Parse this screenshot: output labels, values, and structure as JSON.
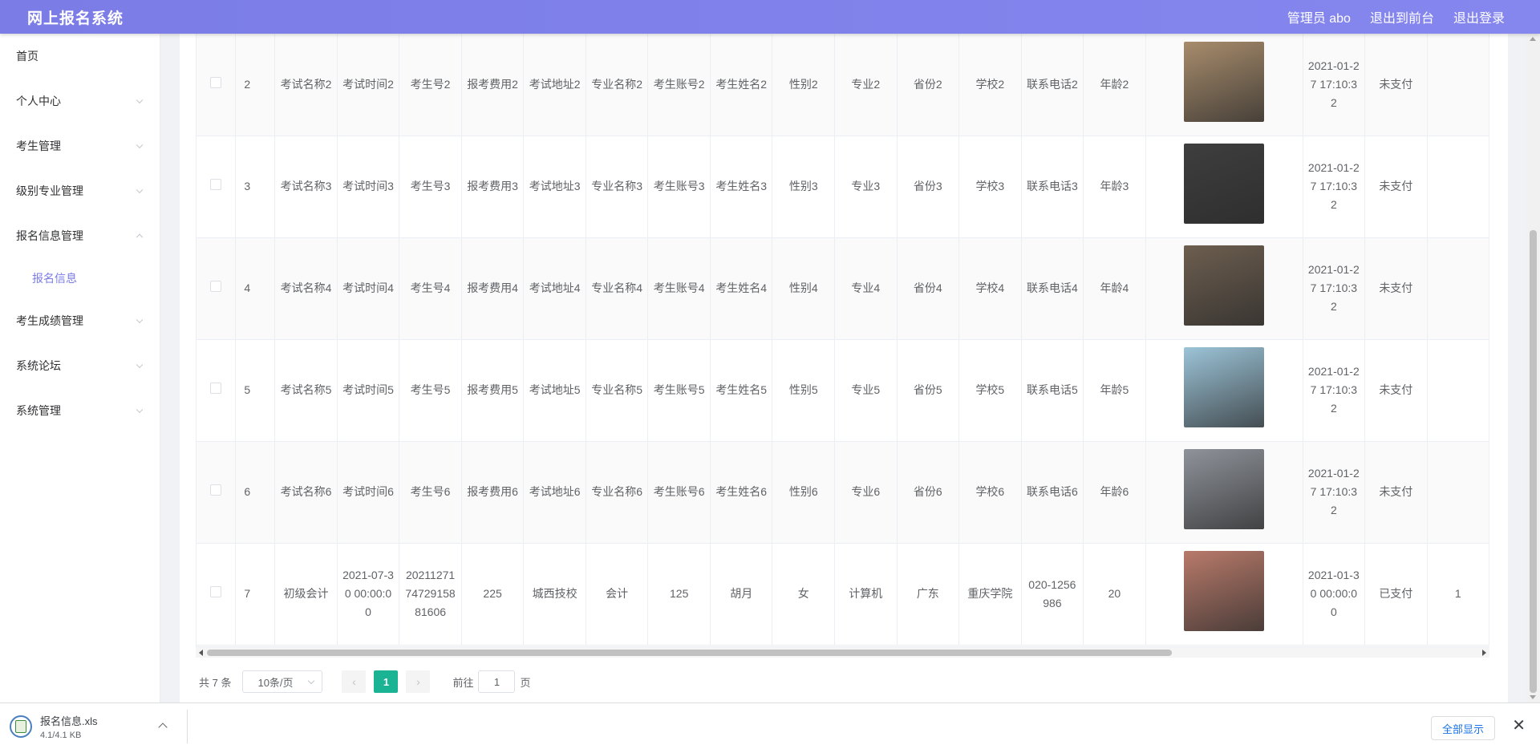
{
  "header": {
    "title": "网上报名系统",
    "admin": "管理员 abo",
    "to_front": "退出到前台",
    "logout": "退出登录"
  },
  "sidebar": {
    "items": [
      {
        "label": "首页"
      },
      {
        "label": "个人中心"
      },
      {
        "label": "考生管理"
      },
      {
        "label": "级别专业管理"
      },
      {
        "label": "报名信息管理"
      },
      {
        "label": "报名信息"
      },
      {
        "label": "考生成绩管理"
      },
      {
        "label": "系统论坛"
      },
      {
        "label": "系统管理"
      }
    ]
  },
  "table": {
    "rows": [
      {
        "idx": "2",
        "exam": "考试名称2",
        "time": "考试时间2",
        "no": "考生号2",
        "fee": "报考费用2",
        "addr": "考试地址2",
        "major": "专业名称2",
        "acct": "考生账号2",
        "name": "考生姓名2",
        "sex": "性别2",
        "prof": "专业2",
        "prov": "省份2",
        "school": "学校2",
        "phone": "联系电话2",
        "age": "年龄2",
        "photo_color": "#a88c6c",
        "created": "2021-01-27 17:10:32",
        "pay": "未支付"
      },
      {
        "idx": "3",
        "exam": "考试名称3",
        "time": "考试时间3",
        "no": "考生号3",
        "fee": "报考费用3",
        "addr": "考试地址3",
        "major": "专业名称3",
        "acct": "考生账号3",
        "name": "考生姓名3",
        "sex": "性别3",
        "prof": "专业3",
        "prov": "省份3",
        "school": "学校3",
        "phone": "联系电话3",
        "age": "年龄3",
        "photo_color": "#3e3e3e",
        "created": "2021-01-27 17:10:32",
        "pay": "未支付"
      },
      {
        "idx": "4",
        "exam": "考试名称4",
        "time": "考试时间4",
        "no": "考生号4",
        "fee": "报考费用4",
        "addr": "考试地址4",
        "major": "专业名称4",
        "acct": "考生账号4",
        "name": "考生姓名4",
        "sex": "性别4",
        "prof": "专业4",
        "prov": "省份4",
        "school": "学校4",
        "phone": "联系电话4",
        "age": "年龄4",
        "photo_color": "#6d5e4f",
        "created": "2021-01-27 17:10:32",
        "pay": "未支付"
      },
      {
        "idx": "5",
        "exam": "考试名称5",
        "time": "考试时间5",
        "no": "考生号5",
        "fee": "报考费用5",
        "addr": "考试地址5",
        "major": "专业名称5",
        "acct": "考生账号5",
        "name": "考生姓名5",
        "sex": "性别5",
        "prof": "专业5",
        "prov": "省份5",
        "school": "学校5",
        "phone": "联系电话5",
        "age": "年龄5",
        "photo_color": "#9cc4d8",
        "created": "2021-01-27 17:10:32",
        "pay": "未支付"
      },
      {
        "idx": "6",
        "exam": "考试名称6",
        "time": "考试时间6",
        "no": "考生号6",
        "fee": "报考费用6",
        "addr": "考试地址6",
        "major": "专业名称6",
        "acct": "考生账号6",
        "name": "考生姓名6",
        "sex": "性别6",
        "prof": "专业6",
        "prov": "省份6",
        "school": "学校6",
        "phone": "联系电话6",
        "age": "年龄6",
        "photo_color": "#8f939a",
        "created": "2021-01-27 17:10:32",
        "pay": "未支付"
      },
      {
        "idx": "7",
        "exam": "初级会计",
        "time": "2021-07-30 00:00:00",
        "no": "202112717472915881606",
        "fee": "225",
        "addr": "城西技校",
        "major": "会计",
        "acct": "125",
        "name": "胡月",
        "sex": "女",
        "prof": "计算机",
        "prov": "广东",
        "school": "重庆学院",
        "phone": "020-1256986",
        "age": "20",
        "photo_color": "#b87a6a",
        "created": "2021-01-30 00:00:00",
        "pay": "已支付",
        "extra": "1"
      }
    ]
  },
  "pager": {
    "total": "共 7 条",
    "size": "10条/页",
    "prev": "‹",
    "page": "1",
    "next": "›",
    "goto_prefix": "前往",
    "goto_value": "1",
    "goto_suffix": "页"
  },
  "download": {
    "filename": "报名信息.xls",
    "size": "4.1/4.1 KB",
    "show_all": "全部显示",
    "close": "✕"
  },
  "colors": {
    "header_bg": "#8586ee",
    "accent": "#7b7ce6",
    "active_page": "#1ab394"
  }
}
